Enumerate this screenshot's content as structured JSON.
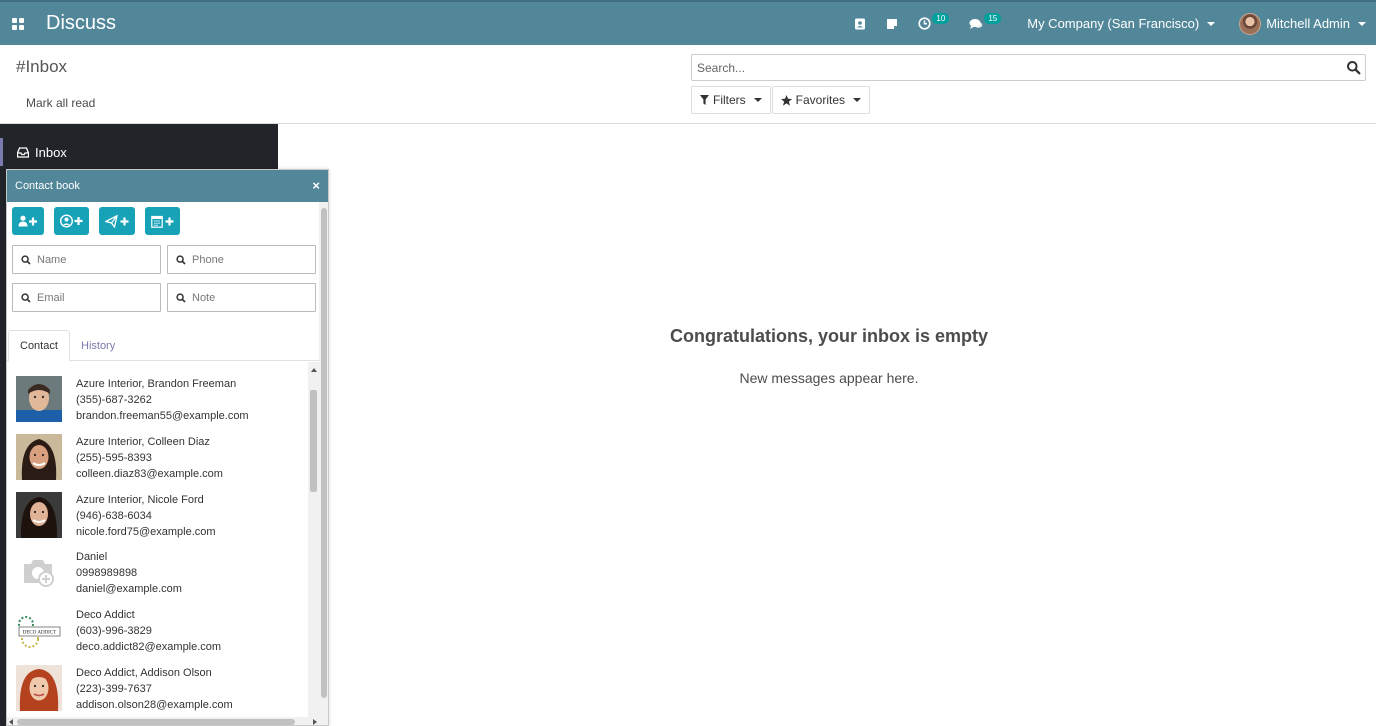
{
  "navbar": {
    "app_title": "Discuss",
    "activities_count": "10",
    "messages_count": "15",
    "company": "My Company (San Francisco)",
    "user": "Mitchell Admin",
    "bg_color": "#52879a"
  },
  "control_panel": {
    "breadcrumb": "#Inbox",
    "mark_all_read": "Mark all read",
    "search_placeholder": "Search...",
    "filters_label": "Filters",
    "favorites_label": "Favorites"
  },
  "sidebar": {
    "items": [
      {
        "label": "Inbox",
        "icon": "inbox-icon"
      }
    ]
  },
  "empty_state": {
    "title": "Congratulations, your inbox is empty",
    "subtitle": "New messages appear here."
  },
  "contact_book": {
    "title": "Contact book",
    "actions": [
      "add-contact",
      "add-company",
      "send-message",
      "schedule"
    ],
    "search_fields": {
      "name_placeholder": "Name",
      "phone_placeholder": "Phone",
      "email_placeholder": "Email",
      "note_placeholder": "Note"
    },
    "tabs": [
      {
        "label": "Contact",
        "active": true
      },
      {
        "label": "History",
        "active": false
      }
    ],
    "contacts": [
      {
        "name": "Azure Interior, Brandon Freeman",
        "phone": "(355)-687-3262",
        "email": "brandon.freeman55@example.com",
        "photo": "man-photo"
      },
      {
        "name": "Azure Interior, Colleen Diaz",
        "phone": "(255)-595-8393",
        "email": "colleen.diaz83@example.com",
        "photo": "woman-photo"
      },
      {
        "name": "Azure Interior, Nicole Ford",
        "phone": "(946)-638-6034",
        "email": "nicole.ford75@example.com",
        "photo": "woman-photo"
      },
      {
        "name": "Daniel",
        "phone": "0998989898",
        "email": "daniel@example.com",
        "photo": "placeholder-camera"
      },
      {
        "name": "Deco Addict",
        "phone": "(603)-996-3829",
        "email": "deco.addict82@example.com",
        "photo": "deco-addict-logo",
        "logo_text": "DECO ADDICT"
      },
      {
        "name": "Deco Addict, Addison Olson",
        "phone": "(223)-399-7637",
        "email": "addison.olson28@example.com",
        "photo": "woman-photo"
      }
    ]
  }
}
